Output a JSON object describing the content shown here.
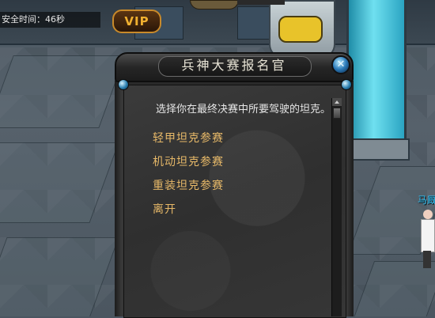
{
  "hud": {
    "safe_time_text": "安全时间：46秒",
    "vip_label": "VIP"
  },
  "world": {
    "npc_name": "马厩"
  },
  "dialog": {
    "title": "兵神大赛报名官",
    "close_icon": "close-orb-icon",
    "prompt": "选择你在最终决赛中所要驾驶的坦克。",
    "options": [
      {
        "label": "轻甲坦克参赛"
      },
      {
        "label": "机动坦克参赛"
      },
      {
        "label": "重装坦克参赛"
      },
      {
        "label": "离开"
      }
    ]
  },
  "colors": {
    "option_text": "#e6b868",
    "prompt_text": "#e6e6e6",
    "title_text": "#e8e4d6",
    "npc_name": "#2fc8ff",
    "vip": "#f0b030"
  }
}
